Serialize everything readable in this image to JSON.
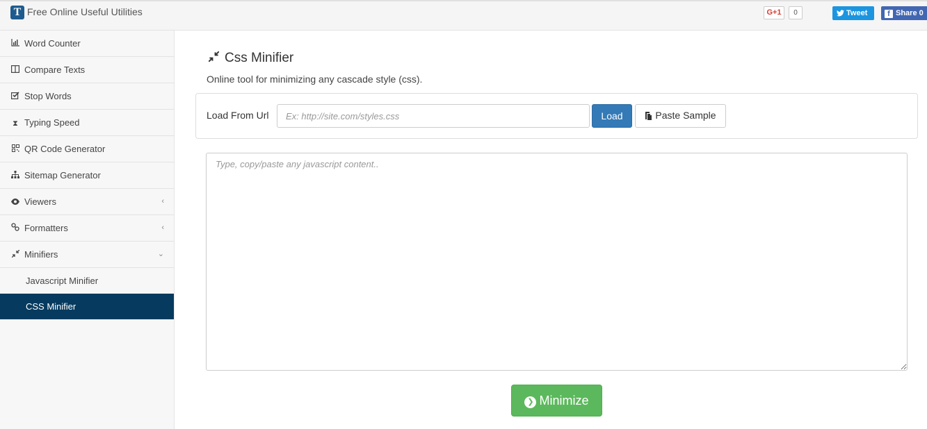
{
  "header": {
    "logo_letter": "T",
    "site_title": "Free Online Useful Utilities",
    "gplus_label": "G+1",
    "gplus_count": "0",
    "tweet_label": "Tweet",
    "share_label": "Share 0"
  },
  "sidebar": {
    "items": [
      {
        "label": "Word Counter",
        "icon": "bar-chart-icon"
      },
      {
        "label": "Compare Texts",
        "icon": "columns-icon"
      },
      {
        "label": "Stop Words",
        "icon": "checkbox-icon"
      },
      {
        "label": "Typing Speed",
        "icon": "hourglass-icon"
      },
      {
        "label": "QR Code Generator",
        "icon": "qrcode-icon"
      },
      {
        "label": "Sitemap Generator",
        "icon": "sitemap-icon"
      },
      {
        "label": "Viewers",
        "icon": "eye-icon"
      },
      {
        "label": "Formatters",
        "icon": "link-icon"
      },
      {
        "label": "Minifiers",
        "icon": "compress-icon"
      }
    ],
    "sub_items": [
      {
        "label": "Javascript Minifier"
      },
      {
        "label": "CSS Minifier"
      }
    ],
    "active": "CSS Minifier"
  },
  "main": {
    "title": "Css Minifier",
    "subtitle": "Online tool for minimizing any cascade style (css).",
    "load_label": "Load From Url",
    "url_placeholder": "Ex: http://site.com/styles.css",
    "url_value": "",
    "load_button": "Load",
    "sample_button": "Paste Sample",
    "editor_placeholder": "Type, copy/paste any javascript content..",
    "editor_value": "",
    "minimize_button": "Minimize"
  },
  "colors": {
    "active_nav": "#063b5f",
    "primary": "#337ab7",
    "success": "#5cb85c",
    "twitter": "#1b95e0",
    "facebook": "#4267b2"
  }
}
